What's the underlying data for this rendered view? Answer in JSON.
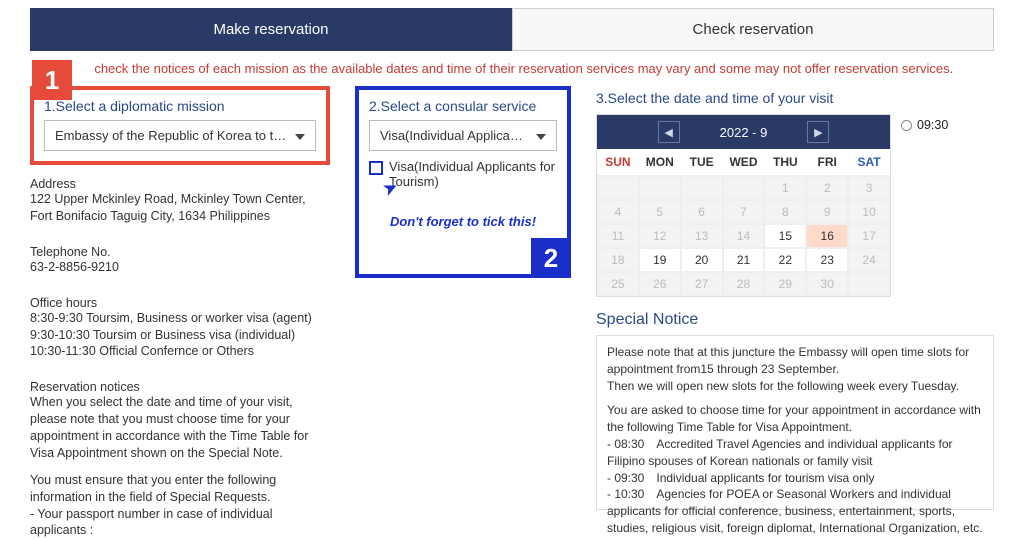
{
  "tabs": {
    "make": "Make reservation",
    "check": "Check reservation"
  },
  "topNotice": "check the notices of each mission as the available dates and time of their reservation services may vary and some may not offer reservation services.",
  "badges": {
    "one": "1",
    "two": "2"
  },
  "step1": {
    "title": "1.Select a diplomatic mission",
    "selected": "Embassy of the Republic of Korea to the Republic"
  },
  "mission": {
    "addressLabel": "Address",
    "address": "122 Upper Mckinley Road, Mckinley Town Center, Fort Bonifacio Taguig City, 1634 Philippines",
    "telLabel": "Telephone No.",
    "tel": "63-2-8856-9210",
    "hoursLabel": "Office hours",
    "hours": "8:30-9:30 Toursim, Business or worker visa (agent) 9:30-10:30 Toursim or Business visa (individual) 10:30-11:30 Official Confernce or Others",
    "noticesLabel": "Reservation notices",
    "notices1": "When you select the date and time of your visit, please note that you must choose time for your appointment in accordance with the Time Table for Visa Appointment shown on the Special Note.",
    "notices2": "You must ensure that you enter the following information in the field of Special Requests.",
    "notices3": "- Your passport number in case of individual applicants :"
  },
  "step2": {
    "title": "2.Select a consular service",
    "selected": "Visa(Individual Applicants for T",
    "option": "Visa(Individual Applicants for Tourism)",
    "hint": "Don't forget to tick this!"
  },
  "step3": {
    "title": "3.Select the date and time of your visit",
    "month": "2022 - 9",
    "dow": [
      "SUN",
      "MON",
      "TUE",
      "WED",
      "THU",
      "FRI",
      "SAT"
    ],
    "timeOption": "09:30"
  },
  "special": {
    "title": "Special Notice",
    "p1": "Please note that at this juncture the Embassy will open time slots for appointment from15 through 23 September.",
    "p2": "Then we will open new slots for the following week every Tuesday.",
    "p3": "You are asked to choose time for your appointment in accordance with the following Time Table for Visa Appointment.",
    "b1": "- 08:30 Accredited Travel Agencies and individual applicants for Filipino spouses of Korean nationals or family visit",
    "b2": "- 09:30 Individual applicants for tourism visa only",
    "b3": "- 10:30 Agencies for POEA or Seasonal Workers and individual applicants for official conference, business, entertainment, sports, studies, religious visit, foreign diplomat, International Organization, etc."
  },
  "calendar": {
    "cells": [
      {
        "t": "",
        "cls": "empty"
      },
      {
        "t": "",
        "cls": "empty"
      },
      {
        "t": "",
        "cls": "empty"
      },
      {
        "t": "",
        "cls": "empty"
      },
      {
        "t": "1",
        "cls": "muted"
      },
      {
        "t": "2",
        "cls": "muted"
      },
      {
        "t": "3",
        "cls": "muted"
      },
      {
        "t": "4",
        "cls": "muted"
      },
      {
        "t": "5",
        "cls": "muted"
      },
      {
        "t": "6",
        "cls": "muted"
      },
      {
        "t": "7",
        "cls": "muted"
      },
      {
        "t": "8",
        "cls": "muted"
      },
      {
        "t": "9",
        "cls": "muted"
      },
      {
        "t": "10",
        "cls": "muted"
      },
      {
        "t": "11",
        "cls": "muted"
      },
      {
        "t": "12",
        "cls": "muted"
      },
      {
        "t": "13",
        "cls": "muted"
      },
      {
        "t": "14",
        "cls": "muted"
      },
      {
        "t": "15",
        "cls": ""
      },
      {
        "t": "16",
        "cls": "hl"
      },
      {
        "t": "17",
        "cls": "muted"
      },
      {
        "t": "18",
        "cls": "muted"
      },
      {
        "t": "19",
        "cls": ""
      },
      {
        "t": "20",
        "cls": ""
      },
      {
        "t": "21",
        "cls": ""
      },
      {
        "t": "22",
        "cls": ""
      },
      {
        "t": "23",
        "cls": ""
      },
      {
        "t": "24",
        "cls": "muted"
      },
      {
        "t": "25",
        "cls": "muted"
      },
      {
        "t": "26",
        "cls": "muted"
      },
      {
        "t": "27",
        "cls": "muted"
      },
      {
        "t": "28",
        "cls": "muted"
      },
      {
        "t": "29",
        "cls": "muted"
      },
      {
        "t": "30",
        "cls": "muted"
      },
      {
        "t": "",
        "cls": "empty"
      }
    ]
  }
}
